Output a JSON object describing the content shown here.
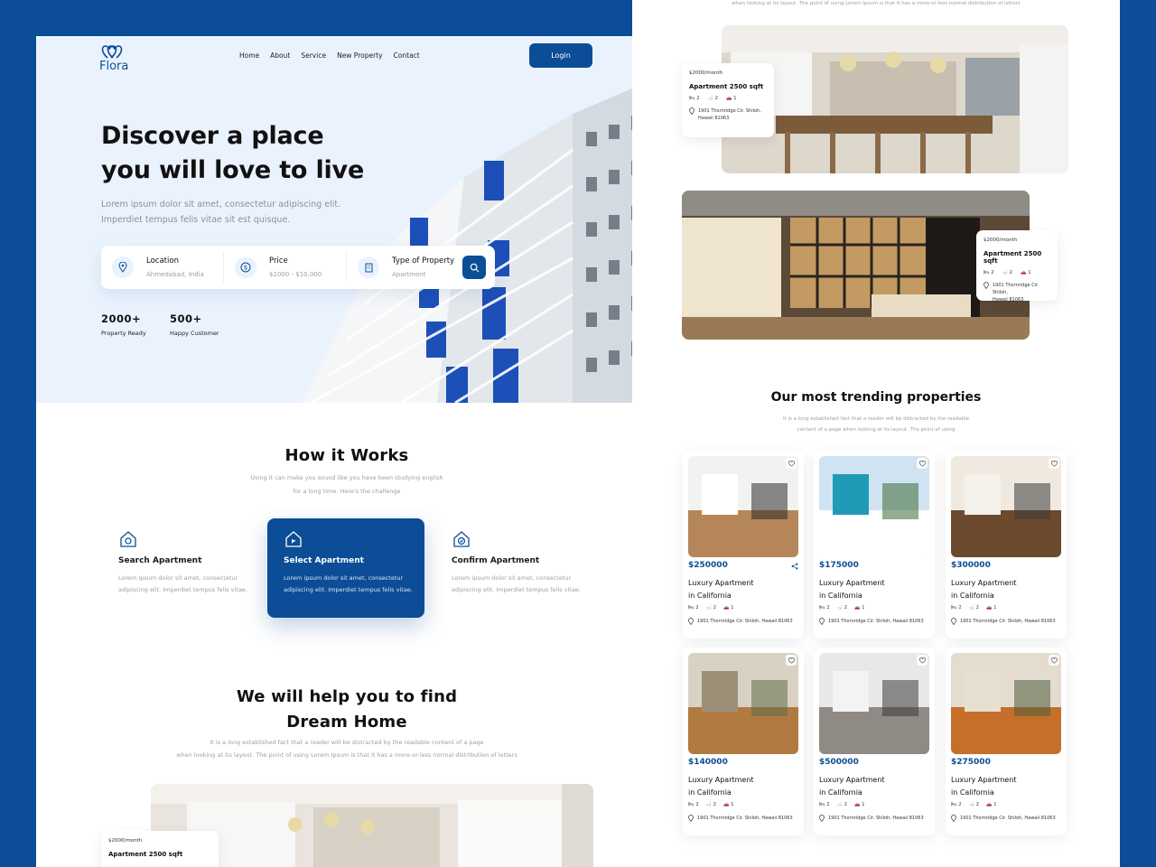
{
  "brand": {
    "name": "Flora"
  },
  "nav": {
    "items": [
      "Home",
      "About",
      "Service",
      "New Property",
      "Contact"
    ],
    "login": "Login"
  },
  "hero": {
    "title_line1": "Discover a place",
    "title_line2": "you will love to live",
    "subtitle_line1": "Lorem ipsum dolor sit amet, consectetur adipiscing elit.",
    "subtitle_line2": "Imperdiet tempus felis vitae sit est quisque.",
    "search": [
      {
        "label": "Location",
        "value": "Ahmedabad, India",
        "icon": "location-pin-icon"
      },
      {
        "label": "Price",
        "value": "$1000 - $10,000",
        "icon": "dollar-icon"
      },
      {
        "label": "Type of Property",
        "value": "Apartment",
        "icon": "building-icon"
      }
    ],
    "stats": [
      {
        "number": "2000+",
        "label": "Property Ready"
      },
      {
        "number": "500+",
        "label": "Happy Customer"
      }
    ]
  },
  "how": {
    "title": "How it Works",
    "subtitle_line1": "Using it can make you sound like you have been studying english",
    "subtitle_line2": "for a long time. Here's the challenge",
    "steps": [
      {
        "title": "Search Apartment",
        "desc": "Lorem ipsum dolor sit amet, consectetur adipiscing elit. Imperdiet tempus felis vitae."
      },
      {
        "title": "Select Apartment",
        "desc": "Lorem ipsum dolor sit amet, consectetur adipiscing elit. Imperdiet tempus felis vitae."
      },
      {
        "title": "Confirm Apartment",
        "desc": "Lorem ipsum dolor sit amet, consectetur adipiscing elit. Imperdiet tempus felis vitae."
      }
    ]
  },
  "help": {
    "title_line1": "We will help you to find",
    "title_line2": "Dream Home",
    "subtitle_line1": "It is a long established fact that a reader will be distracted by the readable content of a page",
    "subtitle_line2": "when looking at its layout. The point of using Lorem Ipsum is that it has a more-or-less normal distribution of letters",
    "card_price": "$2000/month",
    "card_title": "Apartment 2500 sqft"
  },
  "right": {
    "top_text": "when looking at its layout. The point of using Lorem Ipsum is that it has a more-or-less normal distribution of letters",
    "feature_cards": [
      {
        "price": "$2000/month",
        "title": "Apartment 2500 sqft",
        "beds": "2",
        "baths": "2",
        "cars": "1",
        "address_line1": "1901 Thornridge Cir. Shiloh,",
        "address_line2": "Hawaii 81063"
      },
      {
        "price": "$2000/month",
        "title": "Apartment 2500 sqft",
        "beds": "2",
        "baths": "2",
        "cars": "1",
        "address_line1": "1901 Thornridge Cir. Shiloh,",
        "address_line2": "Hawaii 81063"
      }
    ],
    "trending": {
      "title": "Our most trending properties",
      "subtitle_line1": "It is a long established fact that a reader will be distracted by the readable",
      "subtitle_line2": "content of a page when looking at its layout. The point of using"
    },
    "properties": [
      {
        "price": "$250000",
        "title_line1": "Luxury Apartment",
        "title_line2": "in California",
        "beds": "2",
        "baths": "2",
        "cars": "1",
        "address": "1901 Thornridge Cir. Shiloh, Hawaii 81063"
      },
      {
        "price": "$175000",
        "title_line1": "Luxury Apartment",
        "title_line2": "in California",
        "beds": "2",
        "baths": "2",
        "cars": "1",
        "address": "1901 Thornridge Cir. Shiloh, Hawaii 81063"
      },
      {
        "price": "$300000",
        "title_line1": "Luxury Apartment",
        "title_line2": "in California",
        "beds": "2",
        "baths": "2",
        "cars": "1",
        "address": "1901 Thornridge Cir. Shiloh, Hawaii 81063"
      },
      {
        "price": "$140000",
        "title_line1": "Luxury Apartment",
        "title_line2": "in California",
        "beds": "2",
        "baths": "2",
        "cars": "1",
        "address": "1901 Thornridge Cir. Shiloh, Hawaii 81063"
      },
      {
        "price": "$500000",
        "title_line1": "Luxury Apartment",
        "title_line2": "in California",
        "beds": "2",
        "baths": "2",
        "cars": "1",
        "address": "1901 Thornridge Cir. Shiloh, Hawaii 81063"
      },
      {
        "price": "$275000",
        "title_line1": "Luxury Apartment",
        "title_line2": "in California",
        "beds": "2",
        "baths": "2",
        "cars": "1",
        "address": "1901 Thornridge Cir. Shiloh, Hawaii 81063"
      }
    ]
  },
  "colors": {
    "accent": "#0b4d96",
    "hero_bg": "#eaf3fd",
    "frame_bg": "#0b4d96"
  }
}
